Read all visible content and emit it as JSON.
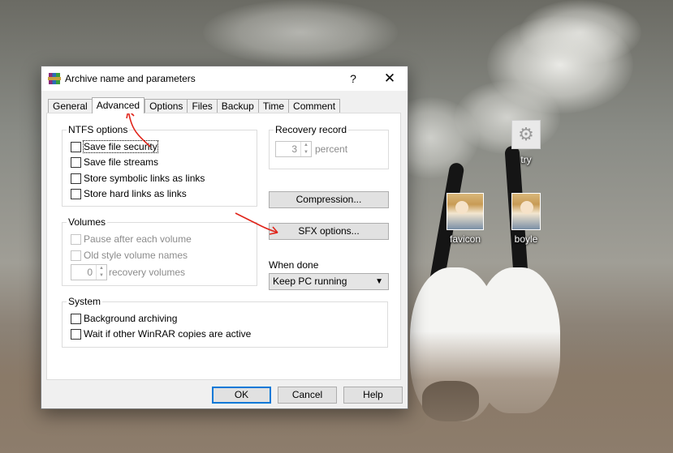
{
  "dialog": {
    "title": "Archive name and parameters",
    "help_glyph": "?",
    "close_glyph": "✕",
    "tabs": [
      {
        "label": "General"
      },
      {
        "label": "Advanced"
      },
      {
        "label": "Options"
      },
      {
        "label": "Files"
      },
      {
        "label": "Backup"
      },
      {
        "label": "Time"
      },
      {
        "label": "Comment"
      }
    ],
    "active_tab": "Advanced",
    "ntfs": {
      "legend": "NTFS options",
      "items": [
        {
          "label": "Save file security",
          "checked": false
        },
        {
          "label": "Save file streams",
          "checked": false
        },
        {
          "label": "Store symbolic links as links",
          "checked": false
        },
        {
          "label": "Store hard links as links",
          "checked": false
        }
      ]
    },
    "recovery": {
      "legend": "Recovery record",
      "value": "3",
      "unit": "percent"
    },
    "volumes": {
      "legend": "Volumes",
      "pause": "Pause after each volume",
      "old_style": "Old style volume names",
      "recovery_value": "0",
      "recovery_label": "recovery volumes"
    },
    "system": {
      "legend": "System",
      "items": [
        {
          "label": "Background archiving",
          "checked": false
        },
        {
          "label": "Wait if other WinRAR copies are active",
          "checked": false
        }
      ]
    },
    "compression_button": "Compression...",
    "sfx_button": "SFX options...",
    "when_done": {
      "label": "When done",
      "selected": "Keep PC running"
    },
    "footer": {
      "ok": "OK",
      "cancel": "Cancel",
      "help": "Help"
    }
  },
  "desktop": {
    "icons": [
      {
        "label": "try",
        "icon": "gear-icon"
      },
      {
        "label": "favicon",
        "icon": "avatar-image"
      },
      {
        "label": "boyle",
        "icon": "avatar-image"
      }
    ]
  },
  "colors": {
    "annotation": "#e0241a",
    "default_button_border": "#0078d7",
    "dialog_background": "#f0f0f0"
  }
}
